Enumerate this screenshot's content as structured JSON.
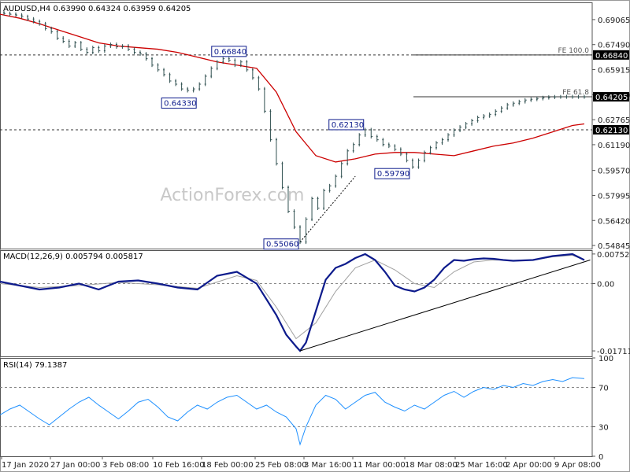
{
  "chart_data": [
    {
      "type": "candlestick",
      "panel": "price",
      "header": {
        "symbol": "AUDUSD,H4",
        "open": "0.63990",
        "high": "0.64324",
        "low": "0.63959",
        "close": "0.64205"
      },
      "watermark": "ActionForex.com",
      "ylim": [
        0.5465,
        0.7015
      ],
      "y_ticks": [
        "0.69065",
        "0.67490",
        "0.65915",
        "0.64340",
        "0.62765",
        "0.61190",
        "0.59570",
        "0.57995",
        "0.56420",
        "0.54845"
      ],
      "x_ticks": [
        "17 Jan 2020",
        "27 Jan 00:00",
        "3 Feb 08:00",
        "10 Feb 16:00",
        "18 Feb 00:00",
        "25 Feb 08:00",
        "3 Mar 16:00",
        "11 Mar 00:00",
        "18 Mar 08:00",
        "25 Mar 16:00",
        "2 Apr 00:00",
        "9 Apr 08:00"
      ],
      "series": [
        {
          "name": "price",
          "color": "#2f4f4f",
          "x": [
            0,
            2,
            5,
            8,
            11,
            14,
            17,
            20,
            23,
            26,
            29,
            32,
            35,
            38,
            41,
            44,
            47,
            50,
            53,
            56,
            59,
            62,
            65,
            68,
            71,
            74,
            77,
            80,
            83,
            86,
            89,
            92,
            95,
            98,
            101,
            104,
            107,
            110,
            113,
            116,
            119,
            122,
            125,
            128,
            131,
            134,
            137,
            140,
            143,
            146,
            149,
            152,
            155,
            158,
            161,
            164,
            167,
            170,
            173,
            176,
            179,
            182,
            185,
            188,
            191,
            194,
            197,
            200,
            203,
            206,
            209,
            212,
            215,
            218,
            221,
            224,
            227,
            230,
            233,
            236,
            239,
            242,
            245,
            248,
            251,
            254,
            257,
            260,
            263,
            266,
            269,
            272,
            275,
            278,
            281,
            284,
            287,
            290,
            293,
            296
          ],
          "y": [
            0.695,
            0.6945,
            0.694,
            0.6935,
            0.6925,
            0.691,
            0.6895,
            0.688,
            0.685,
            0.683,
            0.679,
            0.677,
            0.674,
            0.676,
            0.672,
            0.67,
            0.673,
            0.671,
            0.674,
            0.675,
            0.6735,
            0.674,
            0.672,
            0.67,
            0.669,
            0.666,
            0.662,
            0.659,
            0.656,
            0.652,
            0.65,
            0.647,
            0.646,
            0.647,
            0.65,
            0.655,
            0.66,
            0.664,
            0.666,
            0.665,
            0.662,
            0.664,
            0.659,
            0.654,
            0.647,
            0.633,
            0.615,
            0.6,
            0.585,
            0.57,
            0.56,
            0.5506,
            0.565,
            0.578,
            0.572,
            0.583,
            0.586,
            0.592,
            0.6,
            0.608,
            0.612,
            0.618,
            0.6213,
            0.617,
            0.615,
            0.612,
            0.611,
            0.609,
            0.606,
            0.602,
            0.5979,
            0.602,
            0.607,
            0.61,
            0.613,
            0.615,
            0.618,
            0.621,
            0.623,
            0.625,
            0.627,
            0.629,
            0.63,
            0.631,
            0.633,
            0.635,
            0.637,
            0.638,
            0.639,
            0.64,
            0.6405,
            0.641,
            0.6415,
            0.6418,
            0.642,
            0.642,
            0.6421,
            0.642,
            0.642,
            0.642
          ]
        },
        {
          "name": "MA",
          "color": "#cc0000",
          "x": [
            0,
            10,
            20,
            30,
            40,
            50,
            60,
            70,
            80,
            90,
            100,
            110,
            120,
            130,
            140,
            150,
            160,
            170,
            180,
            190,
            200,
            210,
            220,
            230,
            240,
            250,
            260,
            270,
            280,
            290,
            296
          ],
          "y": [
            0.694,
            0.6915,
            0.688,
            0.684,
            0.68,
            0.676,
            0.674,
            0.673,
            0.672,
            0.67,
            0.667,
            0.664,
            0.662,
            0.66,
            0.645,
            0.62,
            0.605,
            0.601,
            0.603,
            0.606,
            0.607,
            0.607,
            0.606,
            0.605,
            0.608,
            0.611,
            0.613,
            0.616,
            0.62,
            0.624,
            0.625
          ]
        }
      ],
      "horizontal_lines": [
        {
          "value": 0.6684,
          "label": "0.66840",
          "note": "FE 100.0",
          "style": "dashed"
        },
        {
          "value": 0.64205,
          "label": "0.64205",
          "note": "FE 61.8",
          "style": "solid"
        },
        {
          "value": 0.6213,
          "label": "0.62130",
          "note": "",
          "style": "dashed"
        }
      ],
      "annotations": [
        {
          "text": "0.66840",
          "x": 116,
          "y": 0.6684
        },
        {
          "text": "0.64330",
          "x": 101,
          "y": 0.6433
        },
        {
          "text": "0.62130",
          "x": 185,
          "y": 0.6213
        },
        {
          "text": "0.59790",
          "x": 209,
          "y": 0.5979
        },
        {
          "text": "0.55060",
          "x": 152,
          "y": 0.5506
        }
      ]
    },
    {
      "type": "line",
      "panel": "macd",
      "title": "MACD(12,26,9) 0.005794 0.005817",
      "ylim": [
        -0.0185,
        0.0085
      ],
      "y_ticks": [
        "0.007526",
        "0.00",
        "-0.017112"
      ],
      "series": [
        {
          "name": "MACD",
          "color": "#0d1b8c",
          "x": [
            0,
            10,
            20,
            30,
            40,
            50,
            60,
            70,
            80,
            90,
            100,
            110,
            120,
            130,
            140,
            145,
            150,
            152,
            155,
            160,
            165,
            170,
            175,
            180,
            185,
            190,
            195,
            200,
            205,
            210,
            215,
            220,
            225,
            230,
            235,
            240,
            245,
            250,
            255,
            260,
            270,
            280,
            290,
            296
          ],
          "y": [
            0.0005,
            -0.0005,
            -0.0015,
            -0.001,
            0.0,
            -0.0015,
            0.0005,
            0.0008,
            0.0,
            -0.001,
            -0.0015,
            0.002,
            0.003,
            0.0,
            -0.008,
            -0.013,
            -0.016,
            -0.0171,
            -0.015,
            -0.007,
            0.001,
            0.004,
            0.005,
            0.0065,
            0.0075,
            0.006,
            0.003,
            -0.0005,
            -0.0015,
            -0.002,
            -0.001,
            0.001,
            0.004,
            0.006,
            0.0058,
            0.0062,
            0.0064,
            0.0063,
            0.006,
            0.0058,
            0.006,
            0.007,
            0.0075,
            0.006
          ]
        },
        {
          "name": "Signal",
          "color": "#a0a0a0",
          "x": [
            0,
            20,
            40,
            60,
            80,
            100,
            120,
            130,
            140,
            150,
            160,
            170,
            180,
            190,
            200,
            210,
            220,
            230,
            240,
            250,
            260,
            270,
            280,
            290,
            296
          ],
          "y": [
            0.0,
            -0.001,
            -0.0005,
            0.0003,
            -0.0003,
            -0.0012,
            0.002,
            0.0008,
            -0.006,
            -0.014,
            -0.01,
            -0.002,
            0.004,
            0.006,
            0.0035,
            0.0,
            -0.001,
            0.003,
            0.0055,
            0.006,
            0.0059,
            0.006,
            0.0068,
            0.0072,
            0.006
          ]
        }
      ]
    },
    {
      "type": "line",
      "panel": "rsi",
      "title": "RSI(14) 79.1387",
      "ylim": [
        0,
        100
      ],
      "y_ticks": [
        "100",
        "70",
        "30",
        "0"
      ],
      "levels": [
        70,
        30
      ],
      "series": [
        {
          "name": "RSI",
          "color": "#1e90ff",
          "x": [
            0,
            5,
            10,
            15,
            20,
            25,
            30,
            35,
            40,
            45,
            50,
            55,
            60,
            65,
            70,
            75,
            80,
            85,
            90,
            95,
            100,
            105,
            110,
            115,
            120,
            125,
            130,
            135,
            140,
            145,
            150,
            152,
            155,
            160,
            165,
            170,
            175,
            180,
            185,
            190,
            195,
            200,
            205,
            210,
            215,
            220,
            225,
            230,
            235,
            240,
            245,
            250,
            255,
            260,
            265,
            270,
            275,
            280,
            285,
            290,
            296
          ],
          "y": [
            42,
            48,
            52,
            45,
            38,
            32,
            40,
            48,
            55,
            60,
            52,
            45,
            38,
            46,
            55,
            58,
            50,
            40,
            36,
            45,
            52,
            48,
            55,
            60,
            62,
            55,
            48,
            52,
            45,
            40,
            28,
            12,
            30,
            52,
            62,
            58,
            48,
            55,
            62,
            65,
            55,
            50,
            46,
            52,
            48,
            55,
            62,
            66,
            60,
            66,
            70,
            68,
            72,
            70,
            74,
            72,
            76,
            78,
            76,
            80,
            79
          ]
        }
      ]
    }
  ]
}
